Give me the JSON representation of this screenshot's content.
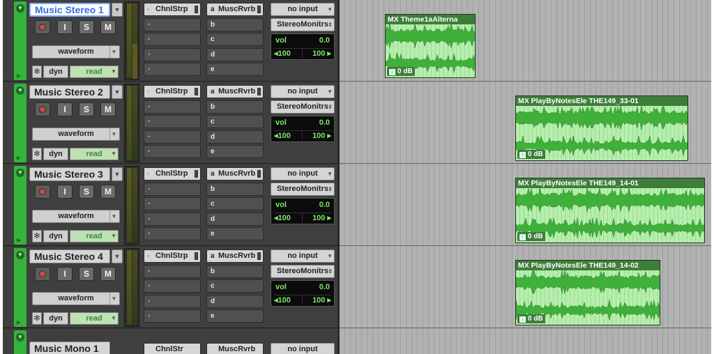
{
  "tracks": [
    {
      "name": "Music Stereo 1",
      "selected": true,
      "buttons": {
        "input": "I",
        "solo": "S",
        "mute": "M"
      },
      "view": "waveform",
      "dyn": "dyn",
      "automation": "read",
      "inserts": [
        "ChnlStrp",
        "",
        "",
        "",
        ""
      ],
      "sends": [
        {
          "letter": "a",
          "label": "MuscRvrb"
        },
        {
          "letter": "b",
          "label": ""
        },
        {
          "letter": "c",
          "label": ""
        },
        {
          "letter": "d",
          "label": ""
        },
        {
          "letter": "e",
          "label": ""
        }
      ],
      "input": "no input",
      "output": "StereoMonitrs",
      "vol_label": "vol",
      "vol_value": "0.0",
      "pan_left": "◂100",
      "pan_right": "100 ▸"
    },
    {
      "name": "Music Stereo 2",
      "selected": false,
      "buttons": {
        "input": "I",
        "solo": "S",
        "mute": "M"
      },
      "view": "waveform",
      "dyn": "dyn",
      "automation": "read",
      "inserts": [
        "ChnlStrp",
        "",
        "",
        "",
        ""
      ],
      "sends": [
        {
          "letter": "a",
          "label": "MuscRvrb"
        },
        {
          "letter": "b",
          "label": ""
        },
        {
          "letter": "c",
          "label": ""
        },
        {
          "letter": "d",
          "label": ""
        },
        {
          "letter": "e",
          "label": ""
        }
      ],
      "input": "no input",
      "output": "StereoMonitrs",
      "vol_label": "vol",
      "vol_value": "0.0",
      "pan_left": "◂100",
      "pan_right": "100 ▸"
    },
    {
      "name": "Music Stereo 3",
      "selected": false,
      "buttons": {
        "input": "I",
        "solo": "S",
        "mute": "M"
      },
      "view": "waveform",
      "dyn": "dyn",
      "automation": "read",
      "inserts": [
        "ChnlStrp",
        "",
        "",
        "",
        ""
      ],
      "sends": [
        {
          "letter": "a",
          "label": "MuscRvrb"
        },
        {
          "letter": "b",
          "label": ""
        },
        {
          "letter": "c",
          "label": ""
        },
        {
          "letter": "d",
          "label": ""
        },
        {
          "letter": "e",
          "label": ""
        }
      ],
      "input": "no input",
      "output": "StereoMonitrs",
      "vol_label": "vol",
      "vol_value": "0.0",
      "pan_left": "◂100",
      "pan_right": "100 ▸"
    },
    {
      "name": "Music Stereo 4",
      "selected": false,
      "buttons": {
        "input": "I",
        "solo": "S",
        "mute": "M"
      },
      "view": "waveform",
      "dyn": "dyn",
      "automation": "read",
      "inserts": [
        "ChnlStrp",
        "",
        "",
        "",
        ""
      ],
      "sends": [
        {
          "letter": "a",
          "label": "MuscRvrb"
        },
        {
          "letter": "b",
          "label": ""
        },
        {
          "letter": "c",
          "label": ""
        },
        {
          "letter": "d",
          "label": ""
        },
        {
          "letter": "e",
          "label": ""
        }
      ],
      "input": "no input",
      "output": "StereoMonitrs",
      "vol_label": "vol",
      "vol_value": "0.0",
      "pan_left": "◂100",
      "pan_right": "100 ▸"
    }
  ],
  "partial_track": {
    "name": "Music Mono 1",
    "insert": "ChnlStr",
    "send": "MuscRvrb",
    "input": "no input"
  },
  "clips": [
    {
      "name": "MX Theme1aAlterna",
      "gain": "0 dB"
    },
    {
      "name": "MX PlayByNotesEle THE149_33-01",
      "gain": "0 dB"
    },
    {
      "name": "MX PlayByNotesEle THE149_14-01",
      "gain": "0 dB"
    },
    {
      "name": "MX PlayByNotesEle THE149_14-02",
      "gain": "0 dB"
    }
  ],
  "colors": {
    "track_color": "#35b33c",
    "clip_body": "#b6efad",
    "clip_header": "#3f7d3a",
    "waveform": "#3fb03a",
    "vol_text": "#7ee96a",
    "selected_name": "#2f6fe0"
  },
  "icons": {
    "record": "record-icon",
    "freeze": "snowflake-icon",
    "io": "io-icon",
    "person": "person-icon",
    "dropdown": "chevron-down-icon",
    "gain": "gain-icon"
  }
}
